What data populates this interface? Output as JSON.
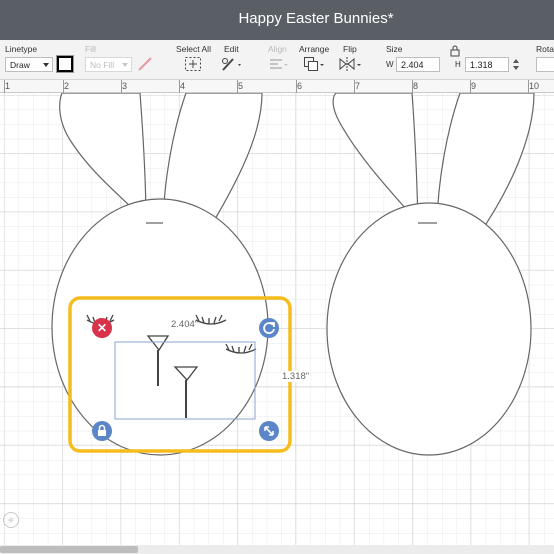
{
  "app": {
    "title": "Happy Easter Bunnies*"
  },
  "toolbar": {
    "linetype_label": "Linetype",
    "linetype_value": "Draw",
    "fill_label": "Fill",
    "fill_value": "No Fill",
    "select_all_label": "Select All",
    "edit_label": "Edit",
    "align_label": "Align",
    "arrange_label": "Arrange",
    "flip_label": "Flip",
    "size_label": "Size",
    "w_label": "W",
    "w_value": "2.404",
    "h_label": "H",
    "h_value": "1.318",
    "rotate_label": "Rotat"
  },
  "ruler": {
    "numbers": [
      "1",
      "2",
      "3",
      "4",
      "5",
      "6",
      "7",
      "8",
      "9",
      "10"
    ]
  },
  "selection": {
    "width_label": "2.404\"",
    "height_label": "1.318\"",
    "accent_color": "#f5bc1b",
    "delete_color": "#d9334b",
    "handle_color": "#5b86c7"
  },
  "zoom_icon": "zoom-in-icon"
}
